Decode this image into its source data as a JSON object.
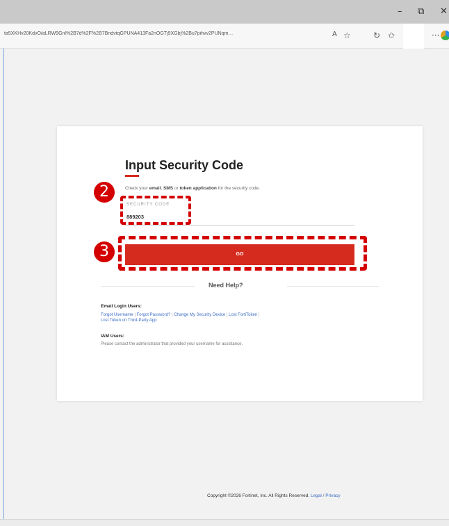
{
  "window": {
    "minimize": "–",
    "restore": "⧉",
    "close": "✕"
  },
  "browser": {
    "url": "ta5XKHv20KdvO/aLRW9Gnl%2B7d%2F%2B7BndvtqGPUNA413Fa2nOGTj9XGbj%2Bu7pihvv2PUNqm…",
    "icons": [
      "read-aloud-icon",
      "favorite-star-icon",
      "refresh-icon",
      "collections-icon",
      "more-icon",
      "edge-logo-icon"
    ]
  },
  "card": {
    "title": "Input Security Code",
    "instruction_prefix": "Check your ",
    "instruction_email": "email",
    "instruction_sep1": ", ",
    "instruction_sms": "SMS",
    "instruction_or": " or ",
    "instruction_token": "token application",
    "instruction_suffix": " for the security code.",
    "field_label": "SECURITY CODE",
    "field_value": "889203",
    "go_label": "GO"
  },
  "annotations": {
    "badge_2": "2",
    "badge_3": "3",
    "color": "#d40000"
  },
  "help": {
    "title": "Need Help?",
    "email_heading": "Email Login Users:",
    "links": [
      "Forgot Username",
      "Forgot Password?",
      "Change My Security Device",
      "Lost FortiToken",
      "Lost Token on Third-Party App"
    ],
    "iam_heading": "IAM Users:",
    "iam_text": "Please contact the administrator that provided your username for assistance."
  },
  "footer": {
    "copyright": "Copyright ©2026 Fortinet, Inc.  All Rights Reserved.",
    "legal": "Legal",
    "slash": "/",
    "privacy": "Privacy"
  },
  "colors": {
    "accent": "#d52b1e",
    "link": "#3b6cc4"
  }
}
